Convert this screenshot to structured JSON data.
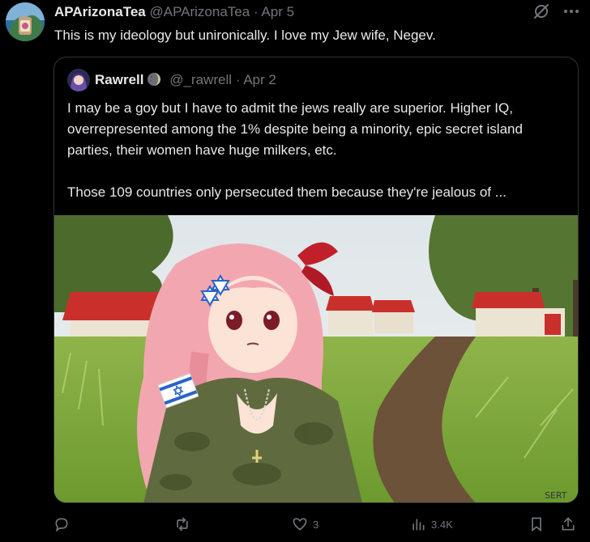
{
  "post": {
    "author_name": "APArizonaTea",
    "author_handle": "@APArizonaTea",
    "separator": "·",
    "date": "Apr 5",
    "text": "This is my ideology but unironically. I love my Jew wife, Negev.",
    "more_icon": "more-horizontal-icon",
    "grok_icon": "grok-icon"
  },
  "quoted": {
    "author_name": "Rawrell",
    "author_handle": "@_rawrell",
    "separator": "·",
    "date": "Apr 2",
    "text": "I may be a goy but I have to admit the jews really are superior. Higher IQ, overrepresented among the 1% despite being a minority, epic secret island parties, their women have huge milkers, etc.\n\nThose 109 countries only persecuted them because they're jealous of ...",
    "media_signature": "SERT"
  },
  "actions": {
    "reply_count": "",
    "repost_count": "",
    "like_count": "3",
    "views_count": "3.4K"
  },
  "colors": {
    "background": "#000000",
    "text": "#e7e9ea",
    "muted": "#71767b",
    "border": "#2f3336"
  }
}
